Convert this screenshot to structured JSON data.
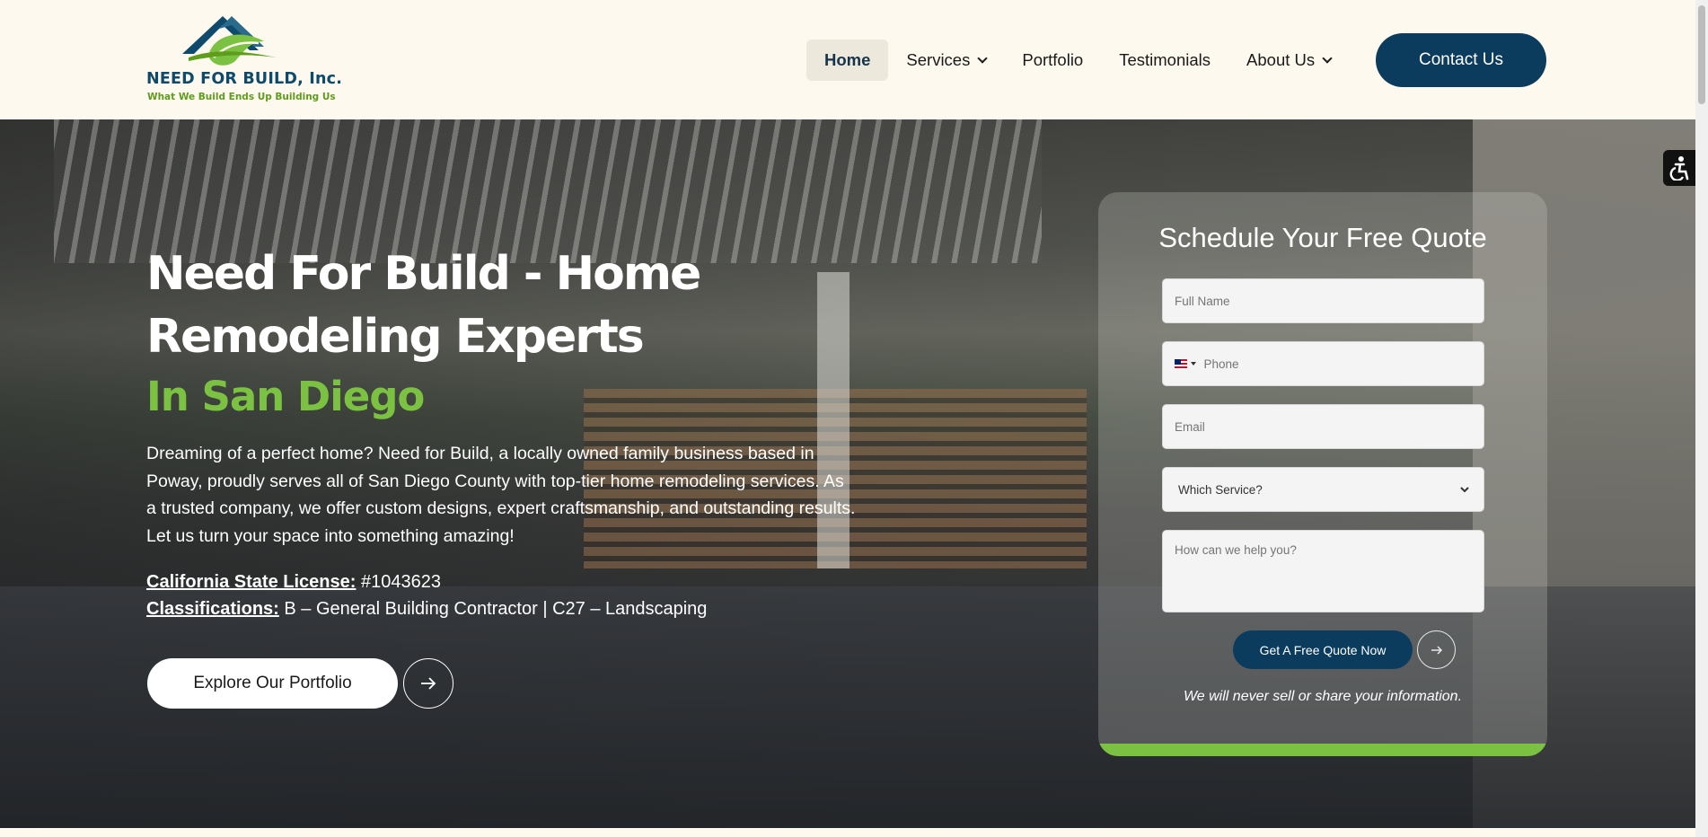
{
  "logo": {
    "name": "NEED FOR BUILD, Inc.",
    "tagline": "What We Build Ends Up Building Us",
    "colors": {
      "navy": "#0e4a6b",
      "green": "#5e9c1c"
    }
  },
  "nav": {
    "items": [
      {
        "label": "Home",
        "active": true
      },
      {
        "label": "Services",
        "dropdown": true
      },
      {
        "label": "Portfolio"
      },
      {
        "label": "Testimonials"
      },
      {
        "label": "About Us",
        "dropdown": true
      }
    ],
    "contact_label": "Contact Us"
  },
  "hero": {
    "title": "Need For Build - Home Remodeling Experts",
    "subtitle": "In San Diego",
    "description": "Dreaming of a perfect home? Need for Build, a locally owned family business based in Poway, proudly serves all of San Diego County with top-tier home remodeling services. As a trusted company, we offer custom designs, expert craftsmanship, and outstanding results. Let us turn your space into something amazing!",
    "license_label": "California State License:",
    "license_value": " #1043623",
    "class_label": "Classifications:",
    "class_value": " B – General Building Contractor | C27 – Landscaping",
    "cta_label": "Explore Our Portfolio"
  },
  "form": {
    "title": "Schedule Your Free Quote",
    "full_name_placeholder": "Full Name",
    "phone_placeholder": "Phone",
    "email_placeholder": "Email",
    "service_selected": "Which Service?",
    "message_placeholder": "How can we help you?",
    "submit_label": "Get A Free Quote Now",
    "privacy": "We will never sell or share your information."
  },
  "colors": {
    "primary": "#0b3c5d",
    "accent_green": "#7cc242",
    "header_bg": "#fdf9ee"
  }
}
